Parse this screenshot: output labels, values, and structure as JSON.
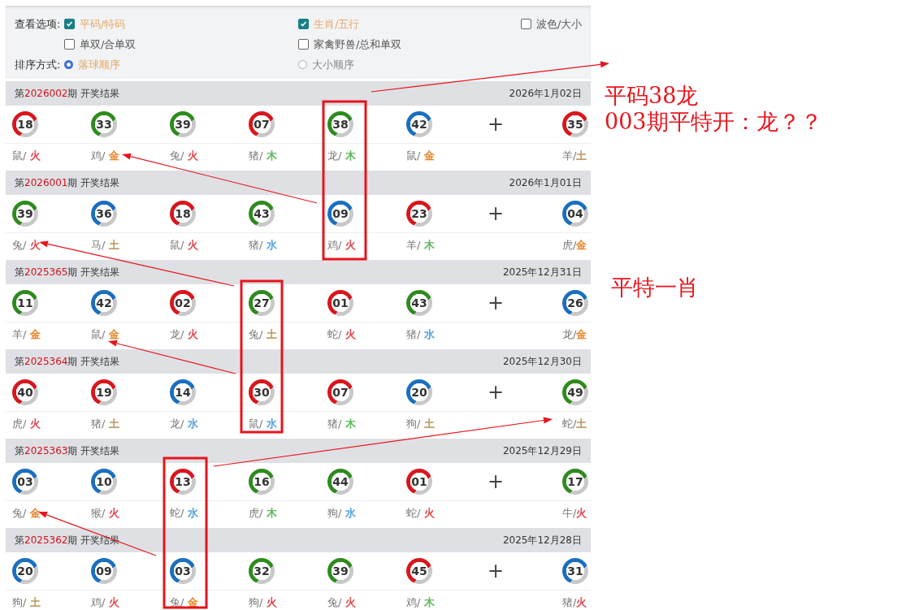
{
  "view_options": {
    "label": "查看选项:",
    "rows": [
      [
        {
          "label": "平码/特码",
          "checked": true
        },
        {
          "label": "生肖/五行",
          "checked": true
        },
        {
          "label": "波色/大小",
          "checked": false
        }
      ],
      [
        {
          "label": "单双/合单双",
          "checked": false
        },
        {
          "label": "家禽野兽/总和单双",
          "checked": false
        }
      ]
    ]
  },
  "sort": {
    "label": "排序方式:",
    "options": [
      {
        "label": "落球顺序",
        "selected": true
      },
      {
        "label": "大小顺序",
        "selected": false
      }
    ]
  },
  "draws": [
    {
      "prefix": "第",
      "issue": "2026002",
      "suffix": "期 开奖结果",
      "date": "2026年1月02日",
      "plus": "+",
      "balls": [
        {
          "number": "18",
          "color": "#d9161c",
          "zodiac": "鼠/ ",
          "element": {
            "text": "火",
            "color": "#e0474c"
          }
        },
        {
          "number": "33",
          "color": "#2e8b1e",
          "zodiac": "鸡/ ",
          "element": {
            "text": "金",
            "color": "#e8862a"
          }
        },
        {
          "number": "39",
          "color": "#2e8b1e",
          "zodiac": "兔/ ",
          "element": {
            "text": "火",
            "color": "#e0474c"
          }
        },
        {
          "number": "07",
          "color": "#d9161c",
          "zodiac": "猪/ ",
          "element": {
            "text": "木",
            "color": "#5cb85c"
          }
        },
        {
          "number": "38",
          "color": "#2e8b1e",
          "zodiac": "龙/ ",
          "element": {
            "text": "木",
            "color": "#5cb85c"
          }
        },
        {
          "number": "42",
          "color": "#1a6fc0",
          "zodiac": "鼠/ ",
          "element": {
            "text": "金",
            "color": "#e8862a"
          }
        }
      ],
      "special": {
        "number": "35",
        "color": "#d9161c",
        "zodiac": "羊/",
        "element": {
          "text": "土",
          "color": "#b8955a"
        }
      }
    },
    {
      "prefix": "第",
      "issue": "2026001",
      "suffix": "期 开奖结果",
      "date": "2026年1月01日",
      "plus": "+",
      "balls": [
        {
          "number": "39",
          "color": "#2e8b1e",
          "zodiac": "兔/ ",
          "element": {
            "text": "火",
            "color": "#e0474c"
          }
        },
        {
          "number": "36",
          "color": "#1a6fc0",
          "zodiac": "马/ ",
          "element": {
            "text": "土",
            "color": "#b8955a"
          }
        },
        {
          "number": "18",
          "color": "#d9161c",
          "zodiac": "鼠/ ",
          "element": {
            "text": "火",
            "color": "#e0474c"
          }
        },
        {
          "number": "43",
          "color": "#2e8b1e",
          "zodiac": "猪/ ",
          "element": {
            "text": "水",
            "color": "#4a9ee0"
          }
        },
        {
          "number": "09",
          "color": "#1a6fc0",
          "zodiac": "鸡/ ",
          "element": {
            "text": "火",
            "color": "#e0474c"
          }
        },
        {
          "number": "23",
          "color": "#d9161c",
          "zodiac": "羊/ ",
          "element": {
            "text": "木",
            "color": "#5cb85c"
          }
        }
      ],
      "special": {
        "number": "04",
        "color": "#1a6fc0",
        "zodiac": "虎/",
        "element": {
          "text": "金",
          "color": "#e8862a"
        }
      }
    },
    {
      "prefix": "第",
      "issue": "2025365",
      "suffix": "期 开奖结果",
      "date": "2025年12月31日",
      "plus": "+",
      "balls": [
        {
          "number": "11",
          "color": "#2e8b1e",
          "zodiac": "羊/ ",
          "element": {
            "text": "金",
            "color": "#e8862a"
          }
        },
        {
          "number": "42",
          "color": "#1a6fc0",
          "zodiac": "鼠/ ",
          "element": {
            "text": "金",
            "color": "#e8862a"
          }
        },
        {
          "number": "02",
          "color": "#d9161c",
          "zodiac": "龙/ ",
          "element": {
            "text": "火",
            "color": "#e0474c"
          }
        },
        {
          "number": "27",
          "color": "#2e8b1e",
          "zodiac": "兔/ ",
          "element": {
            "text": "土",
            "color": "#b8955a"
          }
        },
        {
          "number": "01",
          "color": "#d9161c",
          "zodiac": "蛇/ ",
          "element": {
            "text": "火",
            "color": "#e0474c"
          }
        },
        {
          "number": "43",
          "color": "#2e8b1e",
          "zodiac": "猪/ ",
          "element": {
            "text": "水",
            "color": "#4a9ee0"
          }
        }
      ],
      "special": {
        "number": "26",
        "color": "#1a6fc0",
        "zodiac": "龙/",
        "element": {
          "text": "金",
          "color": "#e8862a"
        }
      }
    },
    {
      "prefix": "第",
      "issue": "2025364",
      "suffix": "期 开奖结果",
      "date": "2025年12月30日",
      "plus": "+",
      "balls": [
        {
          "number": "40",
          "color": "#d9161c",
          "zodiac": "虎/ ",
          "element": {
            "text": "火",
            "color": "#e0474c"
          }
        },
        {
          "number": "19",
          "color": "#d9161c",
          "zodiac": "猪/ ",
          "element": {
            "text": "土",
            "color": "#b8955a"
          }
        },
        {
          "number": "14",
          "color": "#1a6fc0",
          "zodiac": "龙/ ",
          "element": {
            "text": "水",
            "color": "#4a9ee0"
          }
        },
        {
          "number": "30",
          "color": "#d9161c",
          "zodiac": "鼠/ ",
          "element": {
            "text": "水",
            "color": "#4a9ee0"
          }
        },
        {
          "number": "07",
          "color": "#d9161c",
          "zodiac": "猪/ ",
          "element": {
            "text": "木",
            "color": "#5cb85c"
          }
        },
        {
          "number": "20",
          "color": "#1a6fc0",
          "zodiac": "狗/ ",
          "element": {
            "text": "土",
            "color": "#b8955a"
          }
        }
      ],
      "special": {
        "number": "49",
        "color": "#2e8b1e",
        "zodiac": "蛇/",
        "element": {
          "text": "土",
          "color": "#b8955a"
        }
      }
    },
    {
      "prefix": "第",
      "issue": "2025363",
      "suffix": "期 开奖结果",
      "date": "2025年12月29日",
      "plus": "+",
      "balls": [
        {
          "number": "03",
          "color": "#1a6fc0",
          "zodiac": "兔/ ",
          "element": {
            "text": "金",
            "color": "#e8862a"
          }
        },
        {
          "number": "10",
          "color": "#1a6fc0",
          "zodiac": "猴/ ",
          "element": {
            "text": "火",
            "color": "#e0474c"
          }
        },
        {
          "number": "13",
          "color": "#d9161c",
          "zodiac": "蛇/ ",
          "element": {
            "text": "水",
            "color": "#4a9ee0"
          }
        },
        {
          "number": "16",
          "color": "#2e8b1e",
          "zodiac": "虎/ ",
          "element": {
            "text": "木",
            "color": "#5cb85c"
          }
        },
        {
          "number": "44",
          "color": "#2e8b1e",
          "zodiac": "狗/ ",
          "element": {
            "text": "水",
            "color": "#4a9ee0"
          }
        },
        {
          "number": "01",
          "color": "#d9161c",
          "zodiac": "蛇/ ",
          "element": {
            "text": "火",
            "color": "#e0474c"
          }
        }
      ],
      "special": {
        "number": "17",
        "color": "#2e8b1e",
        "zodiac": "牛/",
        "element": {
          "text": "火",
          "color": "#e0474c"
        }
      }
    },
    {
      "prefix": "第",
      "issue": "2025362",
      "suffix": "期 开奖结果",
      "date": "2025年12月28日",
      "plus": "+",
      "balls": [
        {
          "number": "20",
          "color": "#1a6fc0",
          "zodiac": "狗/ ",
          "element": {
            "text": "土",
            "color": "#b8955a"
          }
        },
        {
          "number": "09",
          "color": "#1a6fc0",
          "zodiac": "鸡/ ",
          "element": {
            "text": "火",
            "color": "#e0474c"
          }
        },
        {
          "number": "03",
          "color": "#1a6fc0",
          "zodiac": "兔/ ",
          "element": {
            "text": "金",
            "color": "#e8862a"
          }
        },
        {
          "number": "32",
          "color": "#2e8b1e",
          "zodiac": "狗/ ",
          "element": {
            "text": "火",
            "color": "#e0474c"
          }
        },
        {
          "number": "39",
          "color": "#2e8b1e",
          "zodiac": "兔/ ",
          "element": {
            "text": "火",
            "color": "#e0474c"
          }
        },
        {
          "number": "45",
          "color": "#d9161c",
          "zodiac": "鸡/ ",
          "element": {
            "text": "木",
            "color": "#5cb85c"
          }
        }
      ],
      "special": {
        "number": "31",
        "color": "#1a6fc0",
        "zodiac": "猪/",
        "element": {
          "text": "火",
          "color": "#e0474c"
        }
      }
    }
  ],
  "annotations": [
    {
      "text": "平码38龙"
    },
    {
      "text": "003期平特开：龙？？"
    },
    {
      "text": "平特一肖"
    }
  ]
}
